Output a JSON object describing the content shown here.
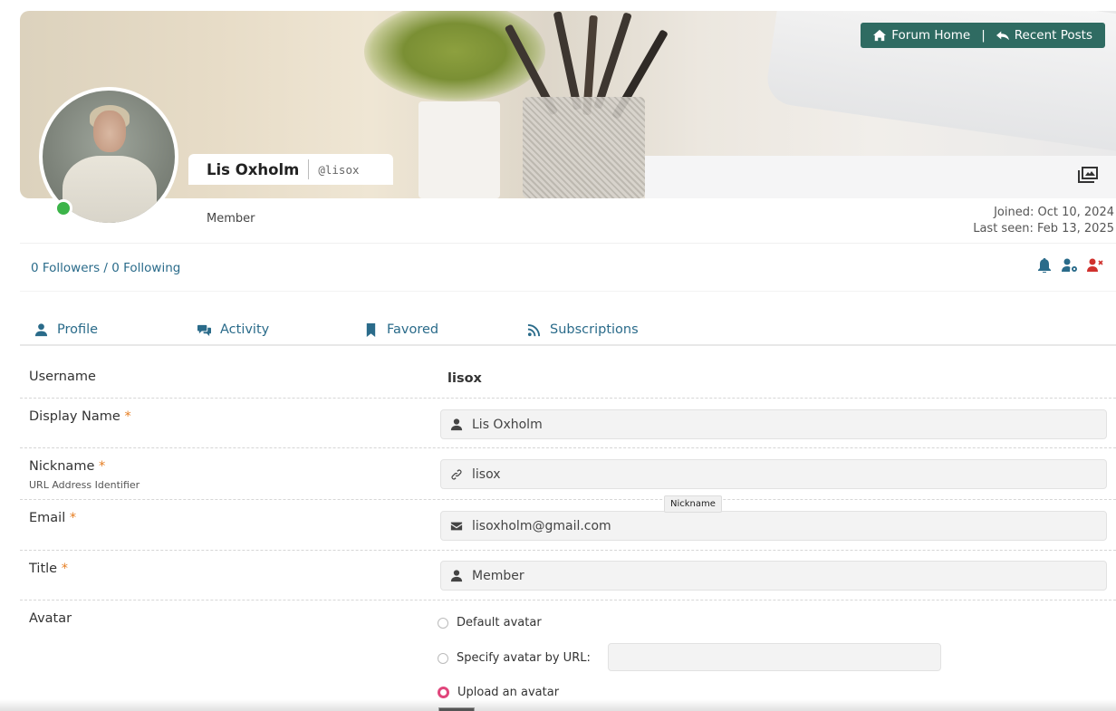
{
  "header": {
    "nav": {
      "forum_home": "Forum Home",
      "separator": "|",
      "recent_posts": "Recent Posts"
    },
    "profile": {
      "display_name": "Lis Oxholm",
      "handle": "@lisox",
      "role": "Member",
      "online": true,
      "joined": "Joined: Oct 10, 2024",
      "last_seen": "Last seen: Feb 13, 2025"
    },
    "follow_text": "0 Followers / 0 Following",
    "action_icons": [
      "bell-icon",
      "user-gear-icon",
      "user-block-icon"
    ]
  },
  "tabs": [
    {
      "label": "Profile",
      "icon": "user-icon",
      "active": true
    },
    {
      "label": "Activity",
      "icon": "comments-icon",
      "active": false
    },
    {
      "label": "Favored",
      "icon": "bookmark-icon",
      "active": false
    },
    {
      "label": "Subscriptions",
      "icon": "rss-icon",
      "active": false
    }
  ],
  "form": {
    "required_mark": "*",
    "username": {
      "label": "Username",
      "value": "lisox"
    },
    "display_name": {
      "label": "Display Name",
      "value": "Lis Oxholm",
      "icon": "user-icon"
    },
    "nickname": {
      "label": "Nickname",
      "sublabel": "URL Address Identifier",
      "value": "lisox",
      "icon": "link-icon",
      "tooltip": "Nickname"
    },
    "email": {
      "label": "Email",
      "value": "lisoxholm@gmail.com",
      "icon": "envelope-icon"
    },
    "title": {
      "label": "Title",
      "value": "Member",
      "icon": "user-icon"
    },
    "avatar": {
      "label": "Avatar",
      "options": [
        {
          "label": "Default avatar",
          "selected": false
        },
        {
          "label": "Specify avatar by URL:",
          "selected": false
        },
        {
          "label": "Upload an avatar",
          "selected": true
        }
      ],
      "url_value": ""
    }
  },
  "colors": {
    "accent": "#2a6b8a",
    "nav_bg": "#2f6b62",
    "required": "#e67e22",
    "online": "#3cb449",
    "radio_selected": "#e0457b",
    "block_icon": "#d0312d"
  }
}
